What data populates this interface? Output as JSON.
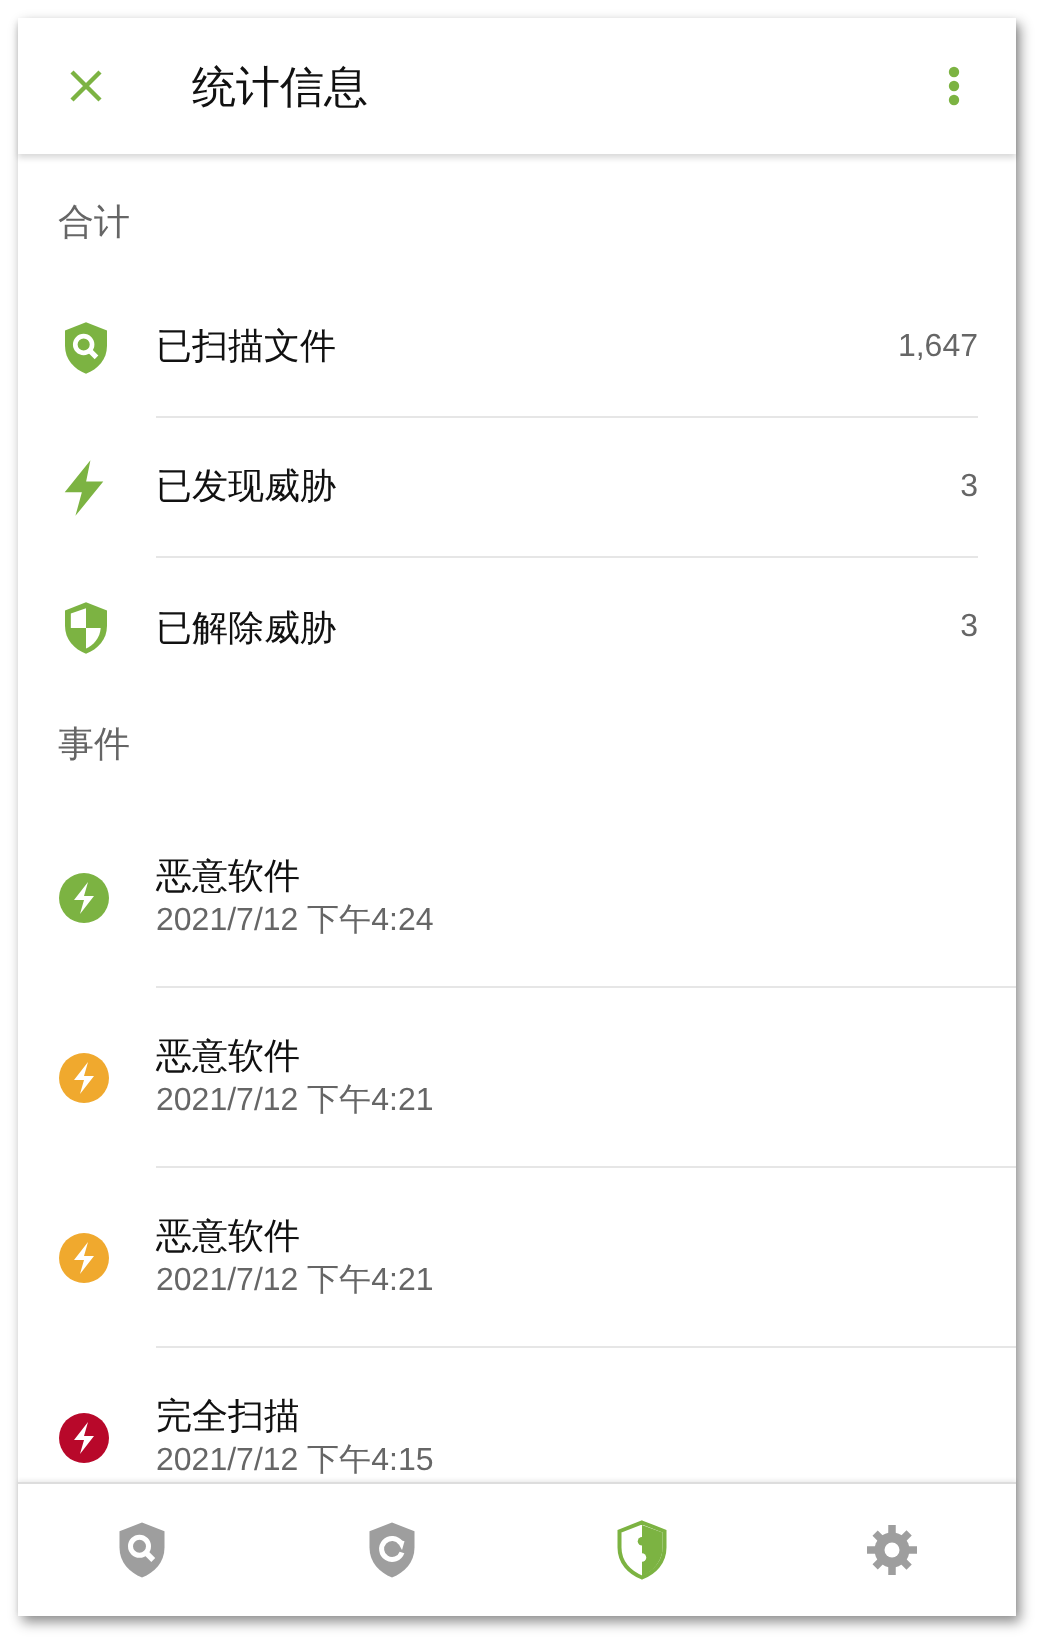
{
  "app_bar": {
    "title": "统计信息"
  },
  "totals": {
    "heading": "合计",
    "items": [
      {
        "kind": "scanned",
        "label": "已扫描文件",
        "value": "1,647"
      },
      {
        "kind": "found",
        "label": "已发现威胁",
        "value": "3"
      },
      {
        "kind": "resolved",
        "label": "已解除威胁",
        "value": "3"
      }
    ]
  },
  "events": {
    "heading": "事件",
    "items": [
      {
        "title": "恶意软件",
        "time": "2021/7/12 下午4:24",
        "color": "#7cb342"
      },
      {
        "title": "恶意软件",
        "time": "2021/7/12 下午4:21",
        "color": "#f0a92e"
      },
      {
        "title": "恶意软件",
        "time": "2021/7/12 下午4:21",
        "color": "#f0a92e"
      },
      {
        "title": "完全扫描",
        "time": "2021/7/12 下午4:15",
        "color": "#b8082a"
      }
    ]
  },
  "bottom_nav": [
    {
      "kind": "scan",
      "selected": false
    },
    {
      "kind": "update",
      "selected": false
    },
    {
      "kind": "protection",
      "selected": true
    },
    {
      "kind": "settings",
      "selected": false
    }
  ]
}
